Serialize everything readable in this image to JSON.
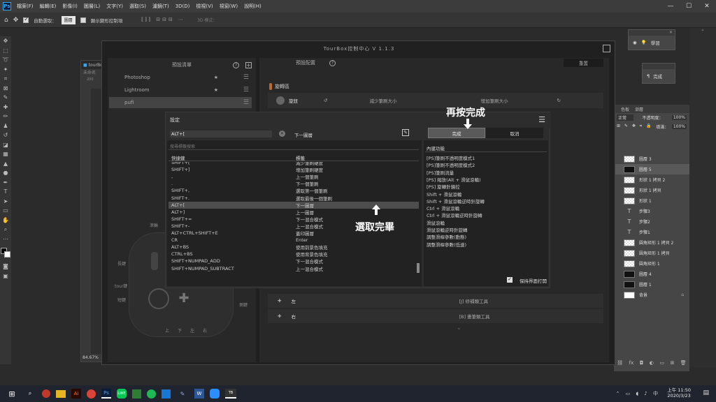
{
  "menubar": {
    "items": [
      "檔案(F)",
      "編輯(E)",
      "影像(I)",
      "圖層(L)",
      "文字(Y)",
      "選取(S)",
      "濾鏡(T)",
      "3D(D)",
      "檢視(V)",
      "視窗(W)",
      "說明(H)"
    ],
    "logo": "Ps",
    "win_min": "—",
    "win_max": "☐",
    "win_close": "✕"
  },
  "options": {
    "auto_select_label": "自動選取：",
    "auto_select_value": "圖層",
    "transform_label": "顯示變形控制項",
    "mode_3d": "3D 模式："
  },
  "doc_tab": {
    "title": "tourBox",
    "ruler_left": "未命名",
    "ruler_num": "200",
    "zoom": "84.67%"
  },
  "right_panels": {
    "learn": "學習",
    "done": "完成",
    "opacity_label": "不透明度：",
    "opacity": "100%",
    "fill_label": "填滿：",
    "fill": "100%",
    "mode": "正常",
    "tab_color": "色板",
    "tab_grad": "漸層"
  },
  "layers": [
    {
      "name": "圖層 3",
      "type": "checker"
    },
    {
      "name": "圖層 5",
      "type": "dark",
      "selected": true
    },
    {
      "name": "形狀 1 拷貝 2",
      "type": "checker"
    },
    {
      "name": "形狀 1 拷貝",
      "type": "checker"
    },
    {
      "name": "形狀 1",
      "type": "checker"
    },
    {
      "name": "步驟3",
      "type": "text"
    },
    {
      "name": "步驟2",
      "type": "text"
    },
    {
      "name": "步驟1",
      "type": "text"
    },
    {
      "name": "圓角矩形 1 拷貝 2",
      "type": "checker"
    },
    {
      "name": "圓角矩形 1 拷貝",
      "type": "checker"
    },
    {
      "name": "圓角矩形 1",
      "type": "checker"
    },
    {
      "name": "圖層 4",
      "type": "dark"
    },
    {
      "name": "圖層 1",
      "type": "dark"
    },
    {
      "name": "背景",
      "type": "white"
    }
  ],
  "tourbox": {
    "title": "TourBox控制中心 V 1.1.3",
    "preset_list_title": "預設清單",
    "presets": [
      "Photoshop",
      "Lightroom",
      "pufi"
    ],
    "preset_config_title": "預設配置",
    "reset": "重置",
    "knob_section": "旋轉區",
    "knob": "旋鈕",
    "knob_left": "減少筆刷大小",
    "knob_right": "增加筆刷大小",
    "dpad_left": "左",
    "dpad_right": "右",
    "dpad_left_action": "[J] 修補類工具",
    "dpad_right_action": "[B] 畫筆類工具",
    "device_labels": {
      "scroll": "滾輪",
      "long": "長鍵",
      "tour": "tour鍵",
      "short": "短鍵",
      "side": "側鍵",
      "top": "頂鍵",
      "up": "上",
      "down": "下",
      "left": "左",
      "right": "右"
    }
  },
  "dialog": {
    "title": "設定",
    "input_value": "ALT+[",
    "target": "下一圖層",
    "search_placeholder": "搜尋標籤搜索",
    "col_key": "快捷鍵",
    "col_label": "標籤",
    "rows": [
      {
        "k": "SHIFT+[",
        "v": "減少筆刷硬度"
      },
      {
        "k": "SHIFT+]",
        "v": "增加筆刷硬度"
      },
      {
        "k": ",",
        "v": "上一個筆刷"
      },
      {
        "k": ".",
        "v": "下一個筆刷"
      },
      {
        "k": "SHIFT+,",
        "v": "選取第一個筆刷"
      },
      {
        "k": "SHIFT+.",
        "v": "選取最後一個筆刷"
      },
      {
        "k": "ALT+[",
        "v": "下一圖層",
        "selected": true
      },
      {
        "k": "ALT+]",
        "v": "上一圖層"
      },
      {
        "k": "SHIFT+=",
        "v": "下一混合模式"
      },
      {
        "k": "SHIFT+-",
        "v": "上一混合模式"
      },
      {
        "k": "ALT+CTRL+SHIFT+E",
        "v": "蓋印圖層"
      },
      {
        "k": "CR",
        "v": "Enter"
      },
      {
        "k": "ALT+BS",
        "v": "使用前景色填充"
      },
      {
        "k": "CTRL+BS",
        "v": "使用背景色填充"
      },
      {
        "k": "SHIFT+NUMPAD_ADD",
        "v": "下一混合模式"
      },
      {
        "k": "SHIFT+NUMPAD_SUBTRACT",
        "v": "上一混合模式"
      }
    ],
    "done": "完成",
    "cancel": "取消",
    "builtin_title": "內建功能",
    "builtin": [
      "[PS]筆刷不透明度模式1",
      "[PS]筆刷不透明度模式2",
      "[PS]筆刷流量",
      "[PS] 縮放(Alt + 滑鼠滾輪)",
      "[PS] 旋轉針鏡控",
      "Shift + 滑鼠滾輪",
      "Shift + 滑鼠滾輪逆時針旋轉",
      "Ctrl + 滑鼠滾輪",
      "Ctrl + 滑鼠滾輪逆時針旋轉",
      "滑鼠滾輪",
      "滑鼠滾輪逆時針旋轉",
      "調整滑桿參數(動態)",
      "調整滑桿參數(低速)"
    ],
    "keep_open": "保持界面打開"
  },
  "annotations": {
    "press_done": "再按完成",
    "select_done": "選取完畢"
  },
  "taskbar": {
    "time": "上午 11:50",
    "date": "2020/3/23"
  }
}
